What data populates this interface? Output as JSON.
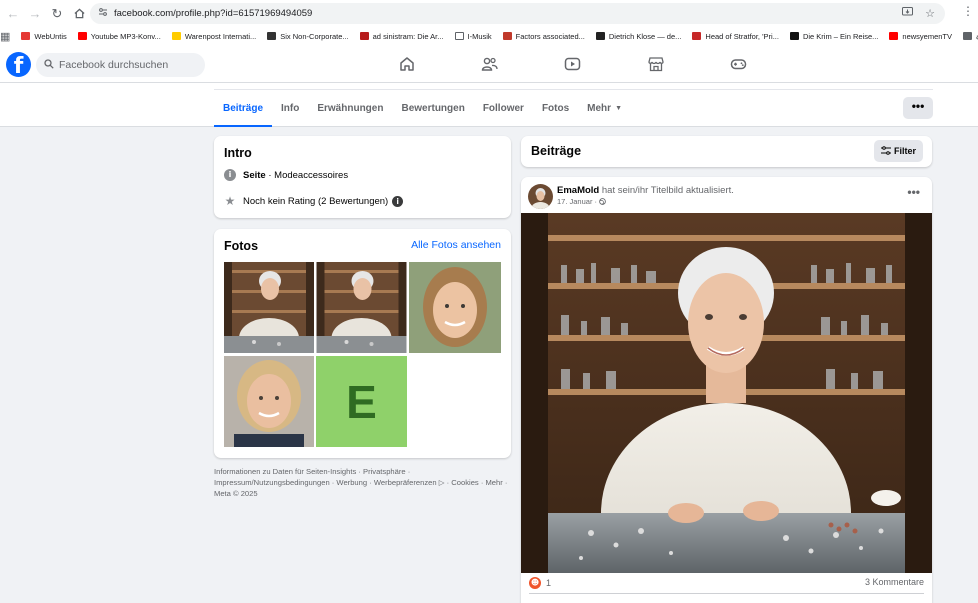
{
  "browser": {
    "url": "facebook.com/profile.php?id=61571969494059",
    "bookmarks": [
      {
        "label": "WebUntis",
        "color": "#e53935"
      },
      {
        "label": "Youtube MP3-Konv...",
        "color": "#ff0000"
      },
      {
        "label": "Warenpost Internati...",
        "color": "#ffcc00"
      },
      {
        "label": "Six Non-Corporate...",
        "color": "#333333"
      },
      {
        "label": "ad sinistram: Die Ar...",
        "color": "#b71c1c"
      },
      {
        "label": "I-Musik",
        "color": "#ffffff"
      },
      {
        "label": "Factors associated...",
        "color": "#c0392b"
      },
      {
        "label": "Dietrich Klose — de...",
        "color": "#222222"
      },
      {
        "label": "Head of Stratfor, 'Pri...",
        "color": "#c62828"
      },
      {
        "label": "Die Krim – Ein Reise...",
        "color": "#111111"
      },
      {
        "label": "newsyemenTV",
        "color": "#ff0000"
      },
      {
        "label": "قناة",
        "color": "#5f6368"
      }
    ]
  },
  "facebook": {
    "search_placeholder": "Facebook durchsuchen",
    "nav_icons": [
      "home-icon",
      "friends-icon",
      "video-icon",
      "marketplace-icon",
      "gaming-icon"
    ]
  },
  "tabs": [
    {
      "label": "Beiträge",
      "active": true
    },
    {
      "label": "Info"
    },
    {
      "label": "Erwähnungen"
    },
    {
      "label": "Bewertungen"
    },
    {
      "label": "Follower"
    },
    {
      "label": "Fotos"
    },
    {
      "label": "Mehr"
    }
  ],
  "more_button": "•••",
  "intro": {
    "title": "Intro",
    "category_bold": "Seite",
    "category_rest": " · Modeaccessoires",
    "rating": "Noch kein Rating (2 Bewertungen)"
  },
  "fotos": {
    "title": "Fotos",
    "link": "Alle Fotos ansehen",
    "letter_tile": "E"
  },
  "footer": {
    "text": "Informationen zu Daten für Seiten-Insights · Privatsphäre · Impressum/Nutzungsbedingungen · Werbung · Werbepräferenzen ▷ · Cookies · Mehr · Meta © 2025"
  },
  "posts_header": {
    "title": "Beiträge",
    "filter": "Filter"
  },
  "post": {
    "author": "EmaMold",
    "action": " hat sein/ihr Titelbild aktualisiert.",
    "date": "17. Januar ·",
    "dots": "•••",
    "reaction_count": "1",
    "comments": "3 Kommentare"
  }
}
